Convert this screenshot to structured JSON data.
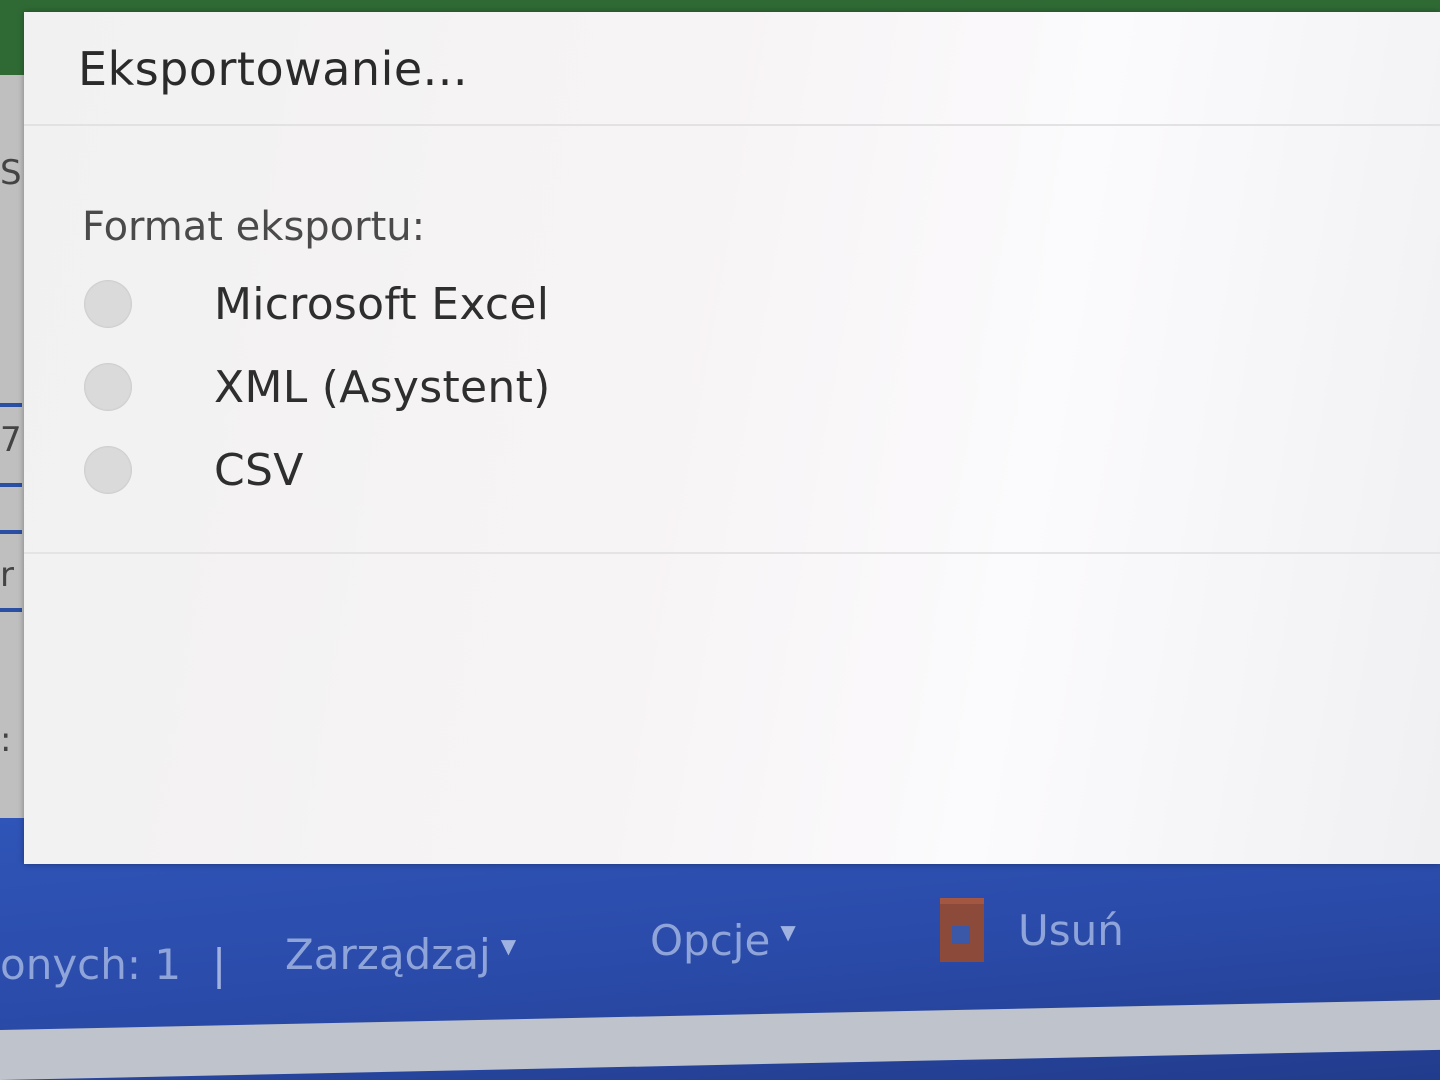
{
  "modal": {
    "title": "Eksportowanie...",
    "format_label": "Format eksportu:",
    "options": [
      {
        "label": "Microsoft Excel",
        "selected": false
      },
      {
        "label": "XML (Asystent)",
        "selected": false
      },
      {
        "label": "CSV",
        "selected": false
      }
    ]
  },
  "toolbar": {
    "count_label": "onych: 1",
    "separator": "|",
    "manage_label": "Zarządzaj",
    "options_label": "Opcje",
    "delete_label": "Usuń",
    "caret_icon": "caret-down-icon",
    "delete_icon": "trash-icon"
  },
  "background": {
    "fragments": [
      "S",
      "7",
      "r",
      ":"
    ]
  },
  "colors": {
    "toolbar_bg": "#2a4aa8",
    "topbar_bg": "#2f6a34",
    "modal_bg": "#f4f4f4",
    "delete_icon": "#8c4a3a"
  }
}
